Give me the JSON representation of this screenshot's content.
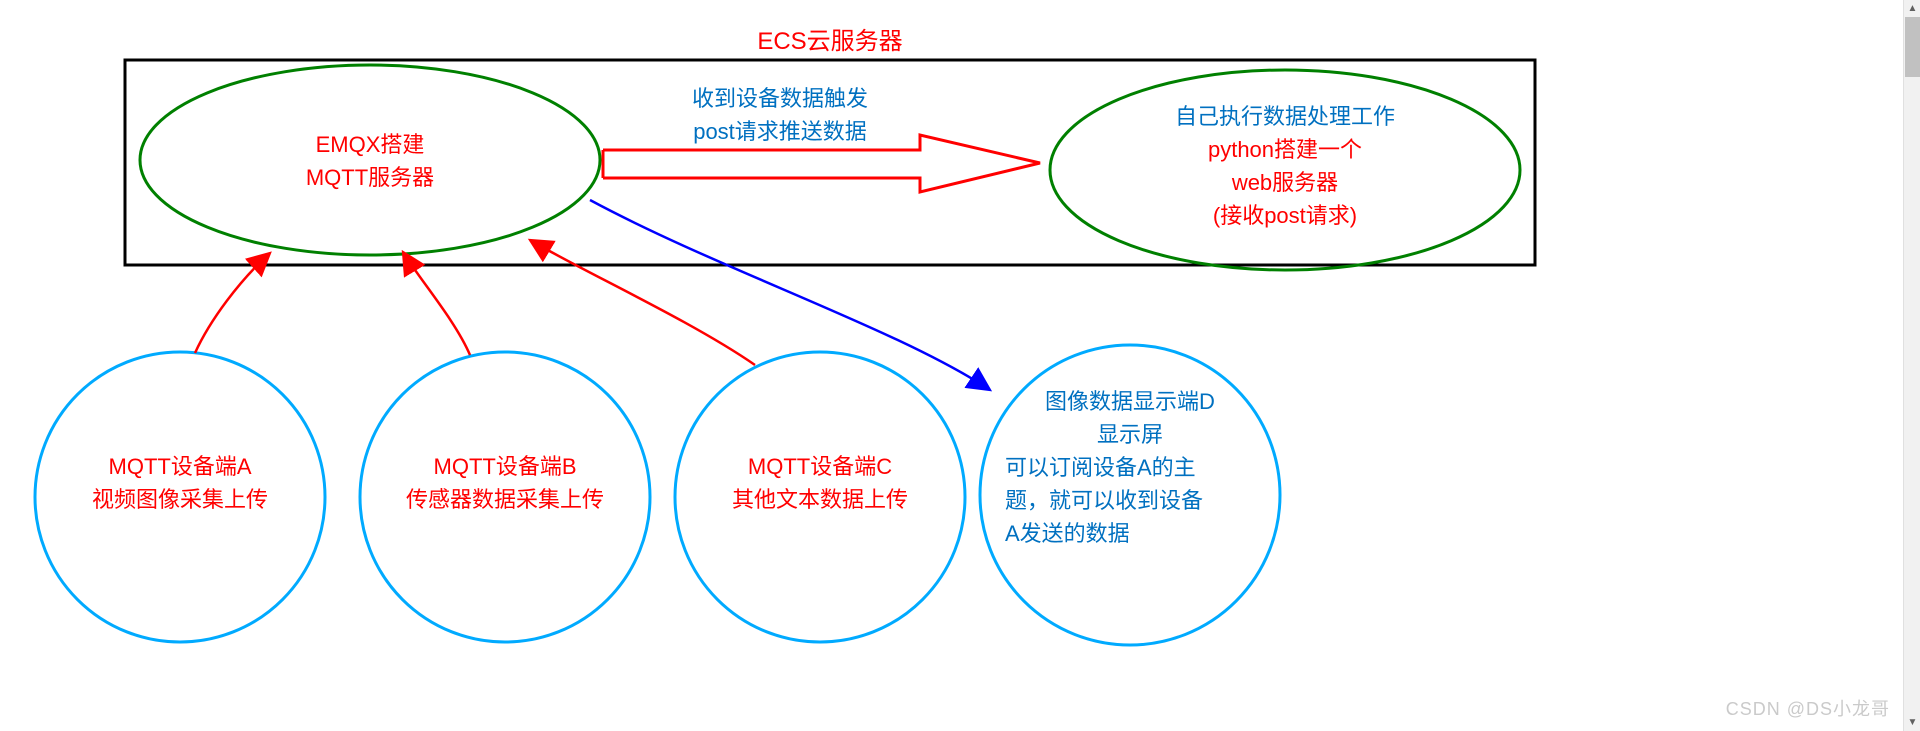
{
  "title": "ECS云服务器",
  "server": {
    "emqx": {
      "line1": "EMQX搭建",
      "line2": "MQTT服务器"
    },
    "web": {
      "line1": "自己执行数据处理工作",
      "line2": "python搭建一个",
      "line3": "web服务器",
      "line4": "(接收post请求)"
    },
    "arrow_label": {
      "line1": "收到设备数据触发",
      "line2": "post请求推送数据"
    }
  },
  "devices": {
    "a": {
      "line1": "MQTT设备端A",
      "line2": "视频图像采集上传"
    },
    "b": {
      "line1": "MQTT设备端B",
      "line2": "传感器数据采集上传"
    },
    "c": {
      "line1": "MQTT设备端C",
      "line2": "其他文本数据上传"
    },
    "d": {
      "line1": "图像数据显示端D",
      "line2": "显示屏",
      "line3": "可以订阅设备A的主",
      "line4": "题，就可以收到设备",
      "line5": "A发送的数据"
    }
  },
  "watermark": "CSDN @DS小龙哥"
}
